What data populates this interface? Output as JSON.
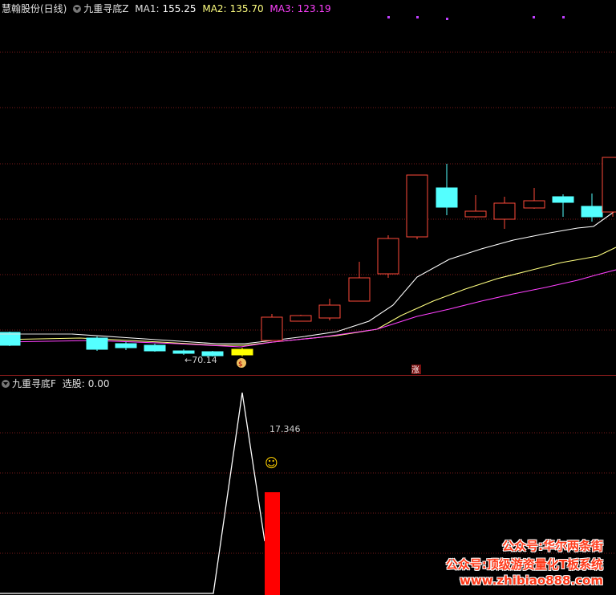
{
  "top": {
    "title": "慧翰股份(日线)",
    "indicator": "九重寻底Z",
    "ma1_label": "MA1:",
    "ma1_value": "155.25",
    "ma2_label": "MA2:",
    "ma2_value": "135.70",
    "ma3_label": "MA3:",
    "ma3_value": "123.19",
    "low_price_label": "←70.14",
    "rise_marker": "涨"
  },
  "bottom": {
    "indicator": "九重寻底F",
    "select_label": "选股:",
    "select_value": "0.00",
    "value_label": "17.346",
    "smile": "☺"
  },
  "watermarks": [
    "公众号:华尔两条街",
    "公众号:顶级游资量化T板系统",
    "www.zhibiao888.com"
  ],
  "colors": {
    "background": "#000000",
    "up_candle": "#ff4a3a",
    "down_candle": "#54ffff",
    "ma1": "#ffffff",
    "ma2": "#ffff80",
    "ma3": "#ff40ff",
    "grid": "#7a1a1a",
    "signal_bar": "#ff0000"
  },
  "chart_data": [
    {
      "type": "candlestick",
      "title": "慧翰股份(日线)",
      "series": [
        {
          "name": "MA1",
          "values": [
            155.25
          ]
        },
        {
          "name": "MA2",
          "values": [
            135.7
          ]
        },
        {
          "name": "MA3",
          "values": [
            123.19
          ]
        }
      ],
      "annotations": [
        "←70.14"
      ]
    },
    {
      "type": "line",
      "title": "九重寻底F",
      "annotations": [
        "选股: 0.00",
        "17.346"
      ]
    }
  ]
}
